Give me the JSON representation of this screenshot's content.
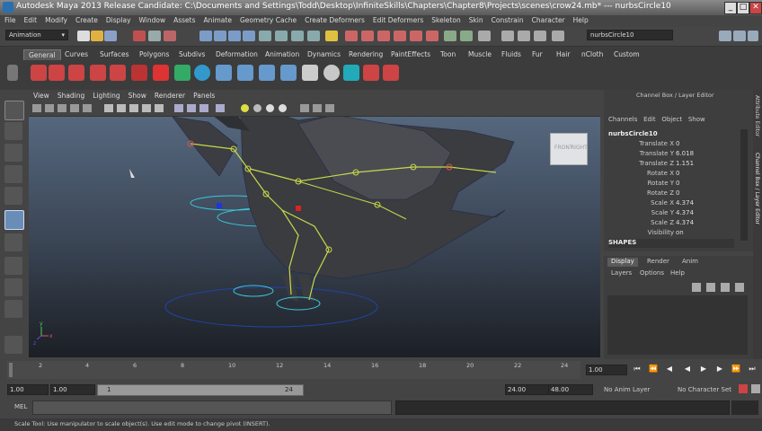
{
  "window": {
    "title": "Autodesk Maya 2013 Release Candidate: C:\\Documents and Settings\\Todd\\Desktop\\InfiniteSkills\\Chapters\\Chapter8\\Projects\\scenes\\crow24.mb*   ---   nurbsCircle10",
    "minimize": "_",
    "maximize": "□",
    "close": "✕"
  },
  "menubar": [
    "File",
    "Edit",
    "Modify",
    "Create",
    "Display",
    "Window",
    "Assets",
    "Animate",
    "Geometry Cache",
    "Create Deformers",
    "Edit Deformers",
    "Skeleton",
    "Skin",
    "Constrain",
    "Character",
    "Help"
  ],
  "statusline": {
    "menu_set": "Animation",
    "selected_object": "nurbsCircle10"
  },
  "shelf": {
    "tabs": [
      "General",
      "Curves",
      "Surfaces",
      "Polygons",
      "Subdivs",
      "Deformation",
      "Animation",
      "Dynamics",
      "Rendering",
      "PaintEffects",
      "Toon",
      "Muscle",
      "Fluids",
      "Fur",
      "Hair",
      "nCloth",
      "Custom"
    ],
    "active_tab": "General"
  },
  "viewport": {
    "menus": [
      "View",
      "Shading",
      "Lighting",
      "Show",
      "Renderer",
      "Panels"
    ],
    "viewcube": {
      "front": "FRONT",
      "right": "RIGHT"
    },
    "axis": {
      "y": "y",
      "x": "x",
      "z": "z"
    }
  },
  "channel_box": {
    "header": "Channel Box / Layer Editor",
    "menus": [
      "Channels",
      "Edit",
      "Object",
      "Show"
    ],
    "object_name": "nurbsCircle10",
    "attributes": [
      {
        "name": "Translate X",
        "value": "0"
      },
      {
        "name": "Translate Y",
        "value": "6.018"
      },
      {
        "name": "Translate Z",
        "value": "1.151"
      },
      {
        "name": "Rotate X",
        "value": "0"
      },
      {
        "name": "Rotate Y",
        "value": "0"
      },
      {
        "name": "Rotate Z",
        "value": "0"
      },
      {
        "name": "Scale X",
        "value": "4.374"
      },
      {
        "name": "Scale Y",
        "value": "4.374"
      },
      {
        "name": "Scale Z",
        "value": "4.374"
      },
      {
        "name": "Visibility",
        "value": "on"
      }
    ],
    "shapes_label": "SHAPES"
  },
  "layer_editor": {
    "tabs": [
      "Display",
      "Render",
      "Anim"
    ],
    "active_tab": "Display",
    "menus": [
      "Layers",
      "Options",
      "Help"
    ]
  },
  "side_tabs": [
    "Attribute Editor",
    "Channel Box / Layer Editor"
  ],
  "time_slider": {
    "ticks": [
      "2",
      "4",
      "6",
      "8",
      "10",
      "12",
      "14",
      "16",
      "18",
      "20",
      "22",
      "24"
    ],
    "current_frame": "1.00"
  },
  "range_slider": {
    "start_time": "1.00",
    "playback_start": "1.00",
    "range_start_label": "1",
    "range_end_label": "24",
    "playback_end": "24.00",
    "end_time": "48.00",
    "anim_layer": "No Anim Layer",
    "character_set": "No Character Set"
  },
  "command_line": {
    "label": "MEL"
  },
  "help_line": {
    "text": "Scale Tool: Use manipulator to scale object(s). Use edit mode to change pivot (INSERT)."
  },
  "colors": {
    "background": "#444444",
    "viewport_top": "#5b6e86",
    "viewport_bottom": "#1c1f25",
    "joint": "#c9d84a",
    "selection": "#2f9ae0"
  }
}
